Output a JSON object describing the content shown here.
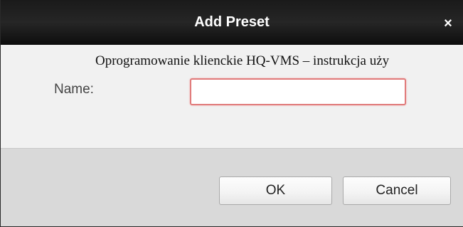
{
  "dialog": {
    "title": "Add Preset",
    "close_glyph": "×",
    "close_icon": "close-icon"
  },
  "watermark": {
    "text": "Oprogramowanie klienckie HQ-VMS – instrukcja uży"
  },
  "form": {
    "name_label": "Name:",
    "name_value": "",
    "name_placeholder": ""
  },
  "buttons": {
    "ok_label": "OK",
    "cancel_label": "Cancel"
  },
  "colors": {
    "titlebar": "#1a1a1a",
    "input_focus_border": "#e07a7a",
    "footer": "#d9d9d9"
  }
}
